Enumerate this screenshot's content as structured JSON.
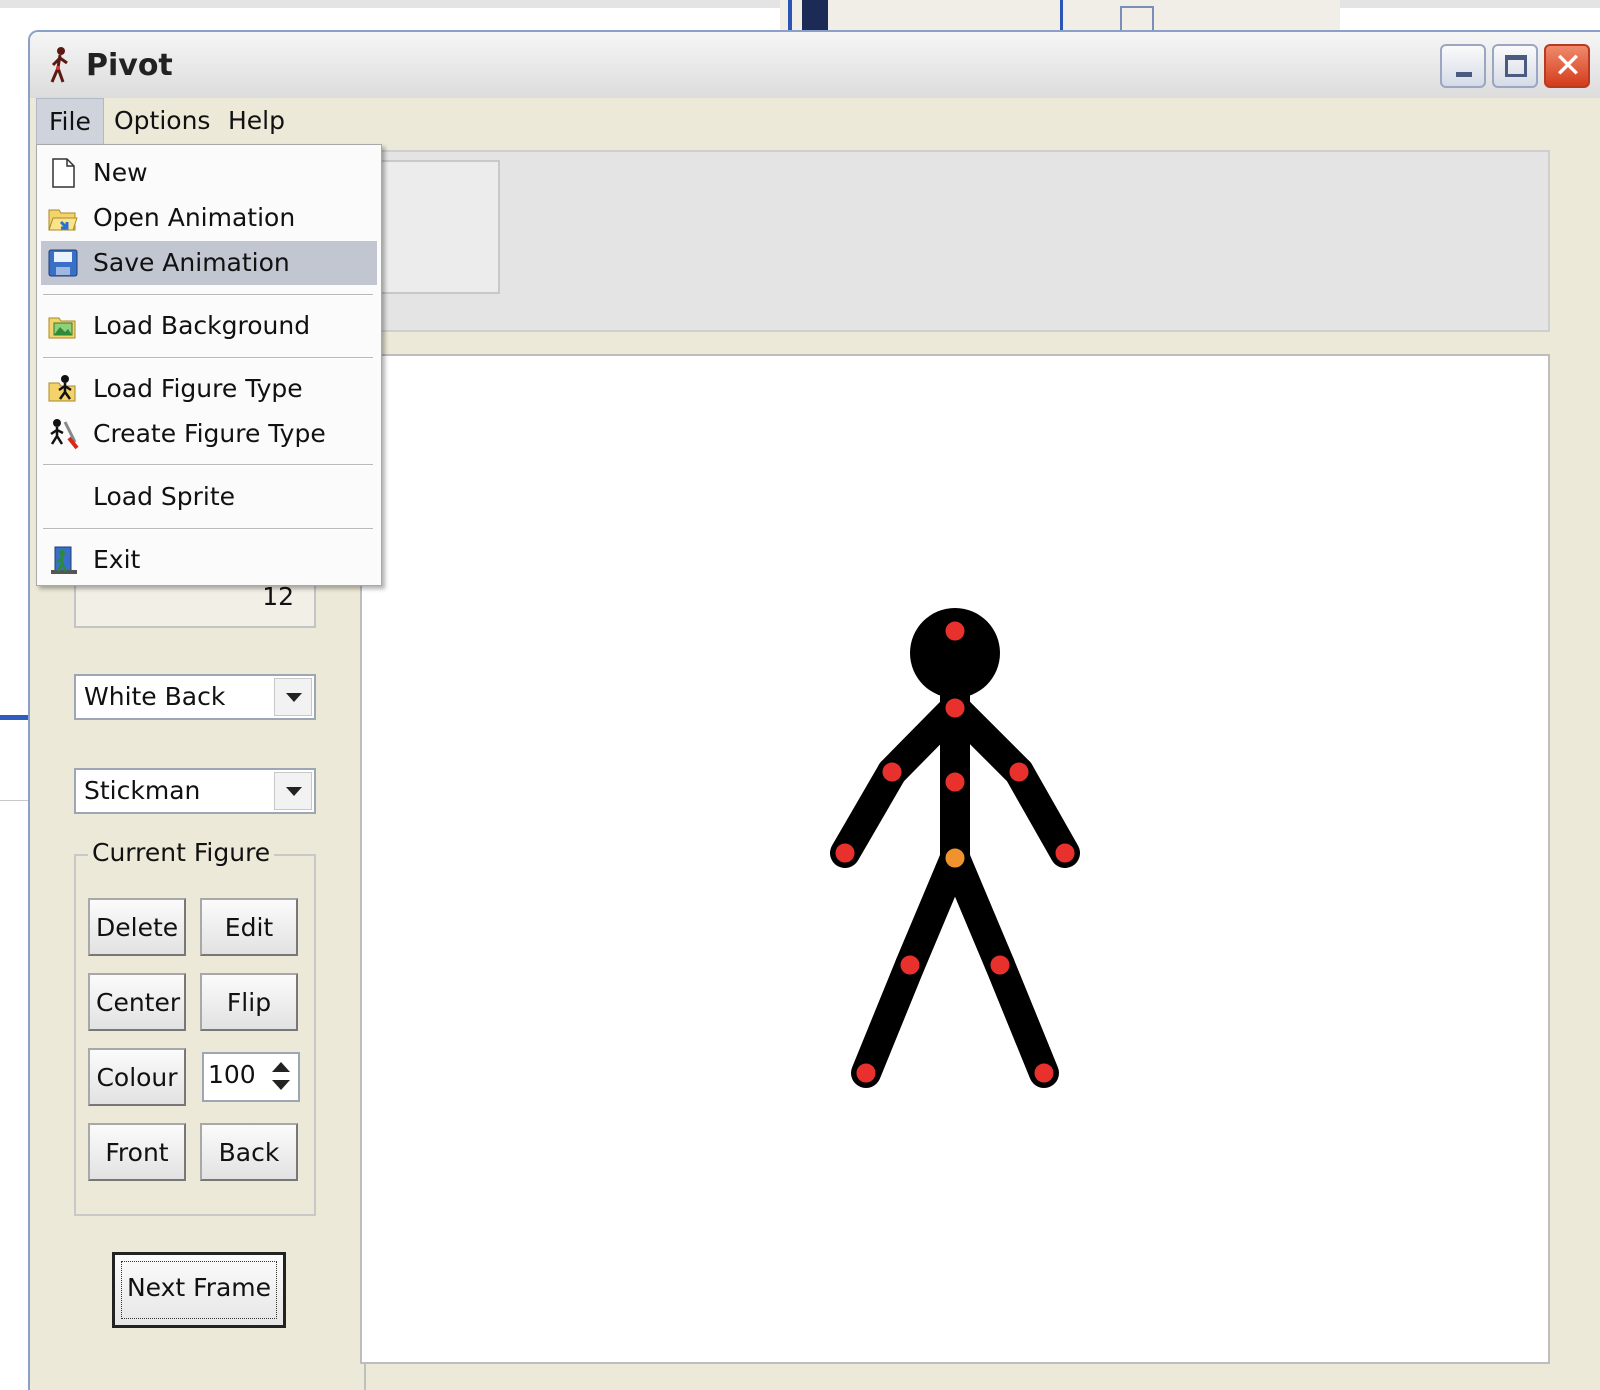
{
  "window": {
    "title": "Pivot"
  },
  "menubar": {
    "file": "File",
    "options": "Options",
    "help": "Help"
  },
  "file_menu": {
    "items": [
      {
        "label": "New",
        "icon": "new-file-icon"
      },
      {
        "label": "Open Animation",
        "icon": "open-folder-icon"
      },
      {
        "label": "Save Animation",
        "icon": "save-disk-icon",
        "highlighted": true
      },
      {
        "label": "Load Background",
        "icon": "image-folder-icon"
      },
      {
        "label": "Load Figure Type",
        "icon": "figure-folder-icon"
      },
      {
        "label": "Create Figure Type",
        "icon": "figure-tools-icon"
      },
      {
        "label": "Load Sprite",
        "icon": ""
      },
      {
        "label": "Exit",
        "icon": "exit-door-icon"
      }
    ]
  },
  "left_panel": {
    "frame_number": "12",
    "background_select": "White Back",
    "figure_select": "Stickman",
    "current_figure": {
      "label": "Current Figure",
      "delete": "Delete",
      "edit": "Edit",
      "center": "Center",
      "flip": "Flip",
      "colour": "Colour",
      "opacity": "100",
      "front": "Front",
      "back": "Back"
    },
    "next_frame": "Next Frame"
  },
  "colors": {
    "figure": "#000000",
    "handle": "#e8302c",
    "center_handle": "#f0932e",
    "title_close": "#d43b1c"
  }
}
